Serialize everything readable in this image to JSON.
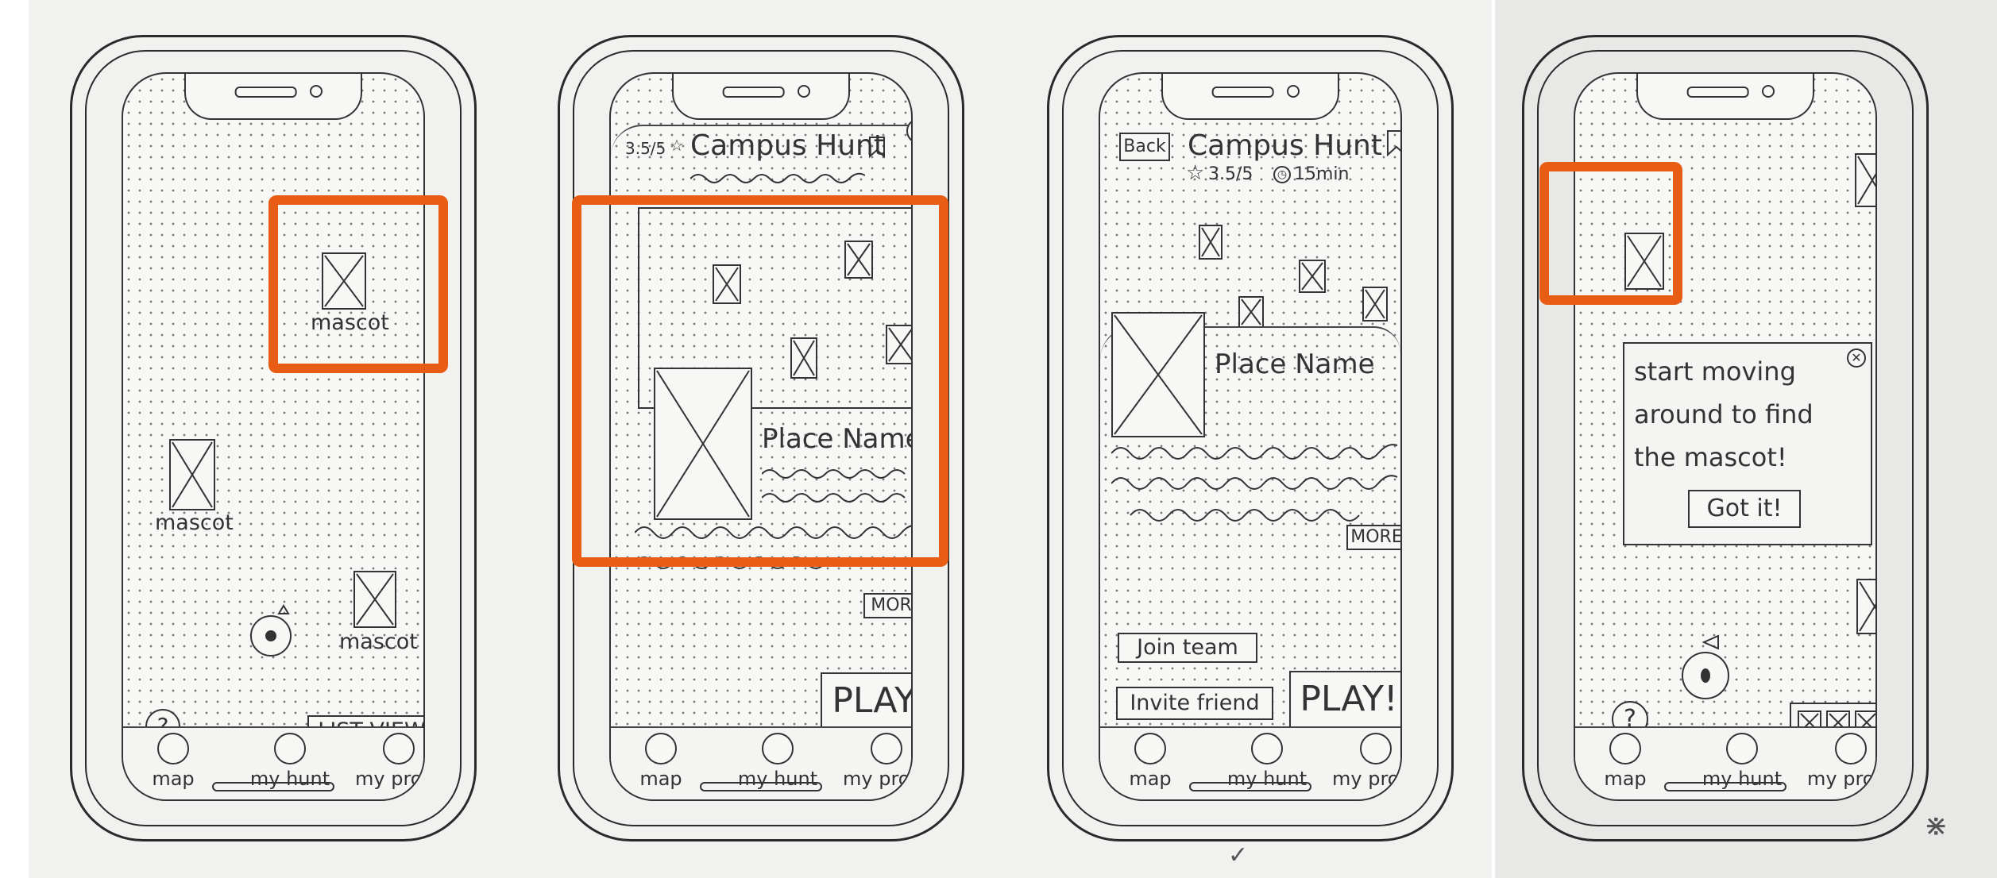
{
  "tabs": [
    "map",
    "my hunt",
    "my profile"
  ],
  "screen1": {
    "mascot_top_label": "mascot",
    "mascot_left_label": "mascot",
    "mascot_bottom_label": "mascot",
    "help_icon": "?",
    "list_view_label": "LIST VIEW"
  },
  "screen2": {
    "rating": "3.5/5",
    "title": "Campus Hunt",
    "place_name": "Place Name",
    "more_label": "MORE",
    "play_label": "PLAY!"
  },
  "screen3": {
    "back_label": "Back",
    "title": "Campus Hunt",
    "rating": "3.5/5",
    "duration": "15min",
    "place_name": "Place Name",
    "more_label": "MORE",
    "join_team_label": "Join team",
    "invite_friend_label": "Invite friend",
    "play_label": "PLAY!"
  },
  "screen4": {
    "dialog_line1": "start moving",
    "dialog_line2": "around to find",
    "dialog_line3": "the mascot!",
    "got_it_label": "Got it!",
    "help_icon": "?"
  },
  "colors": {
    "highlight": "#e85d13",
    "ink": "#333333",
    "paper": "#f1f1ef"
  }
}
